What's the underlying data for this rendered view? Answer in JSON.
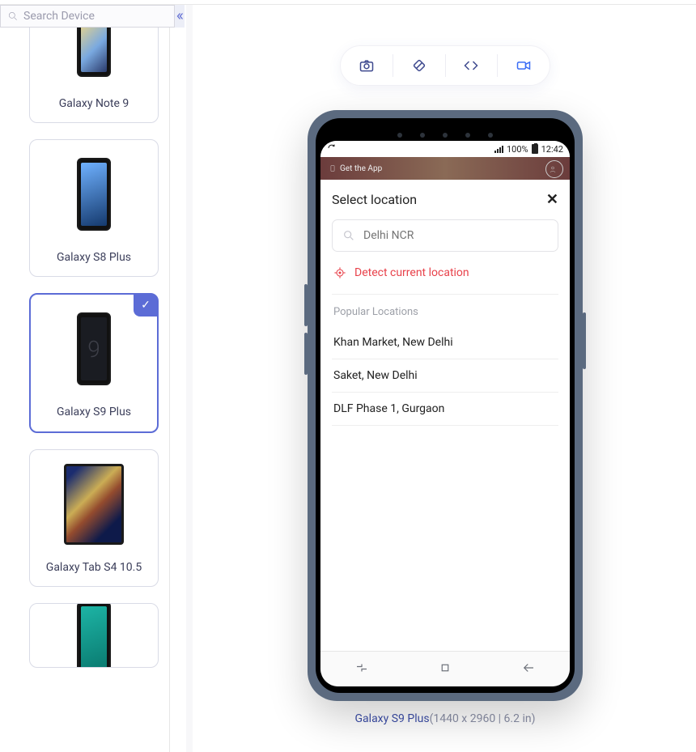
{
  "sidebar": {
    "search_placeholder": "Search Device",
    "devices": [
      {
        "name": "Galaxy Note 9",
        "selected": false,
        "kind": "phone",
        "screen_class": "sc-note9"
      },
      {
        "name": "Galaxy S8 Plus",
        "selected": false,
        "kind": "phone",
        "screen_class": "sc-s8"
      },
      {
        "name": "Galaxy S9 Plus",
        "selected": true,
        "kind": "phone",
        "screen_class": "sc-s9"
      },
      {
        "name": "Galaxy Tab S4 10.5",
        "selected": false,
        "kind": "tablet",
        "screen_class": ""
      },
      {
        "name": "",
        "selected": false,
        "kind": "phone",
        "screen_class": "sc-pixel"
      }
    ]
  },
  "toolbar": {
    "items": [
      "screenshot",
      "rotate",
      "code",
      "record"
    ],
    "active": "record"
  },
  "statusbar": {
    "battery_pct": "100%",
    "time": "12:42"
  },
  "app_header": {
    "banner_text": "Get the App"
  },
  "modal": {
    "title": "Select location",
    "input_placeholder": "Delhi NCR",
    "detect_label": "Detect current location",
    "popular_label": "Popular Locations",
    "locations": [
      "Khan Market, New Delhi",
      "Saket, New Delhi",
      "DLF Phase 1, Gurgaon"
    ]
  },
  "caption": {
    "name": "Galaxy S9 Plus",
    "spec": "(1440 x 2960 | 6.2 in)"
  }
}
